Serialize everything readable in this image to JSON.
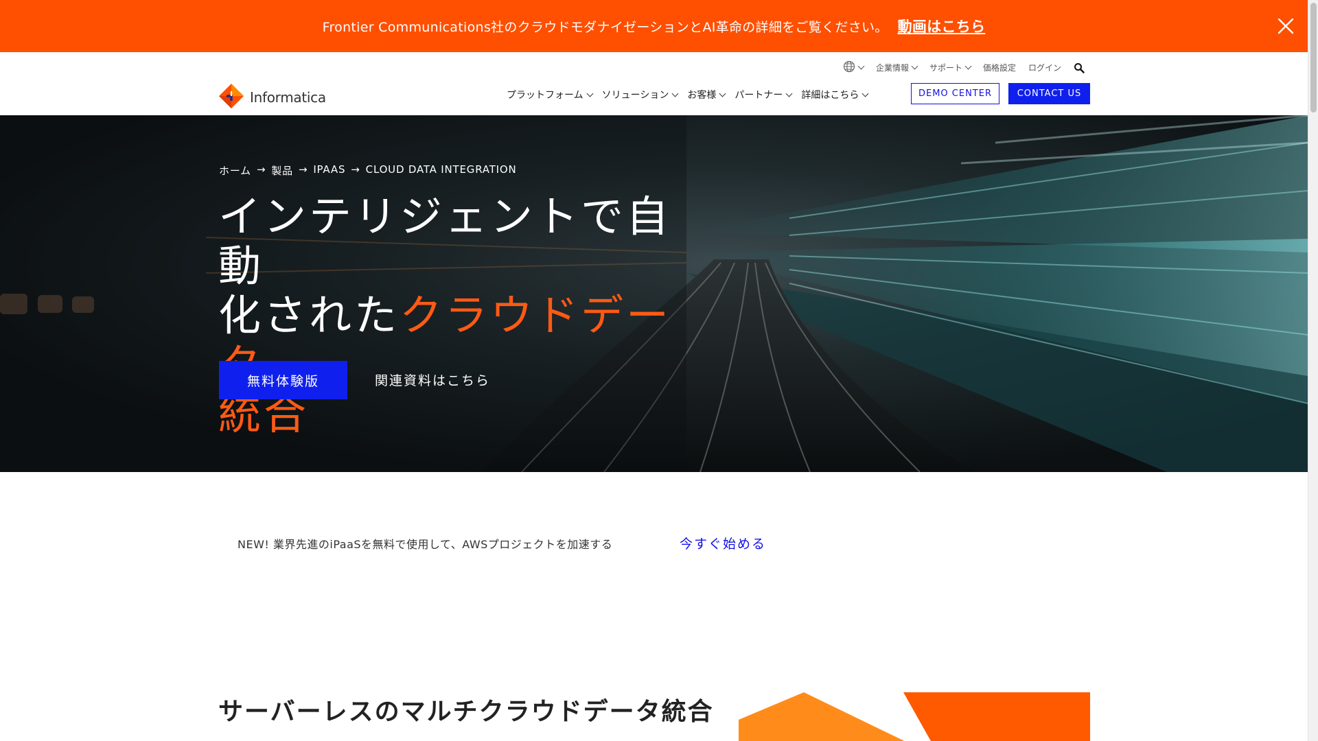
{
  "banner": {
    "text": "Frontier Communications社のクラウドモダナイゼーションとAI革命の詳細をご覧ください。",
    "link": "動画はこちら",
    "close_icon": "close-icon",
    "bg_color": "#ff4f00"
  },
  "utility_nav": {
    "globe_icon": "globe-icon",
    "items": [
      "企業情報",
      "サポート",
      "価格設定",
      "ログイン"
    ],
    "search_icon": "search-icon"
  },
  "logo": {
    "text": "Informatica"
  },
  "main_nav": {
    "items": [
      "プラットフォーム",
      "ソリューション",
      "お客様",
      "パートナー",
      "詳細はこちら"
    ],
    "demo_button": "DEMO CENTER",
    "contact_button": "CONTACT US",
    "accent_color": "#0f20ee"
  },
  "hero": {
    "breadcrumb": [
      "ホーム",
      "製品",
      "IPAAS",
      "CLOUD DATA INTEGRATION"
    ],
    "breadcrumb_separator": "→",
    "title_line1": "インテリジェントで自動",
    "title_line2_white": "化された",
    "title_line2_accent": "クラウドデータ",
    "title_line3_accent": "統合",
    "trial_button": "無料体験版",
    "resources_link": "関連資料はこちら",
    "accent_color": "#ff5a14"
  },
  "promo": {
    "text": "NEW! 業界先進のiPaaSを無料で使用して、AWSプロジェクトを加速する",
    "link": "今すぐ始める"
  },
  "section": {
    "title": "サーバーレスのマルチクラウドデータ統合"
  }
}
